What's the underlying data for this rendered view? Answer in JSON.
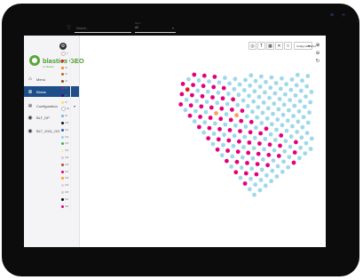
{
  "app": {
    "brand": "blastics GEO",
    "brand_sub": "by Maxam"
  },
  "sidebar": {
    "items": [
      {
        "label": "Menu",
        "icon": "home-icon"
      },
      {
        "label": "Blasts",
        "icon": "globe-icon",
        "active": true
      },
      {
        "label": "Configuration",
        "icon": "gear-icon",
        "has_caret": true
      },
      {
        "label": "BLT_DP",
        "icon": "blast-icon"
      },
      {
        "label": "BLT_2011_OG",
        "icon": "blast-icon"
      }
    ]
  },
  "header": {
    "search_placeholder": "Search...",
    "filter_label": "Mine",
    "filter_value": "All"
  },
  "toolbar": {
    "buttons": [
      "target-icon",
      "text-icon",
      "grid-icon",
      "cross-icon",
      "square-icon"
    ],
    "color_select": "Código de Barra"
  },
  "right_tools": [
    "zoom-in-icon",
    "zoom-out-icon",
    "reset-icon"
  ],
  "legend": {
    "items": [
      {
        "label": "0",
        "color": "#ffffff"
      },
      {
        "label": "01",
        "color": "#e41a1c"
      },
      {
        "label": "02",
        "color": "#ff7f0e"
      },
      {
        "label": "03",
        "color": "#b5651d"
      },
      {
        "label": "04",
        "color": "#8b4513"
      },
      {
        "label": "05",
        "color": "#7b2d8b"
      },
      {
        "label": "06",
        "color": "#4b0082"
      },
      {
        "label": "07",
        "color": "#f5e26b"
      },
      {
        "label": "08",
        "color": "#ffffff"
      },
      {
        "label": "09",
        "color": "#6db6d9"
      },
      {
        "label": "010",
        "color": "#111111"
      },
      {
        "label": "011",
        "color": "#2a5caa"
      },
      {
        "label": "012",
        "color": "#9ad3ea"
      },
      {
        "label": "013",
        "color": "#3cb44b"
      },
      {
        "label": "014",
        "color": "#f5f5a0"
      },
      {
        "label": "015",
        "color": "#d8c2ea"
      },
      {
        "label": "016",
        "color": "#a0522d"
      },
      {
        "label": "017",
        "color": "#e4007c"
      },
      {
        "label": "018",
        "color": "#ff9f1c"
      },
      {
        "label": "019",
        "color": "#f2c6d6"
      },
      {
        "label": "020",
        "color": "#cfcfcf"
      },
      {
        "label": "021",
        "color": "#000000"
      },
      {
        "label": "022",
        "color": "#e4007c"
      }
    ]
  },
  "colors": {
    "accent": "#1d4e89",
    "magenta": "#e4007c",
    "light_blue": "#9ed8ea",
    "red": "#e41a1c",
    "orange": "#f4a261"
  }
}
